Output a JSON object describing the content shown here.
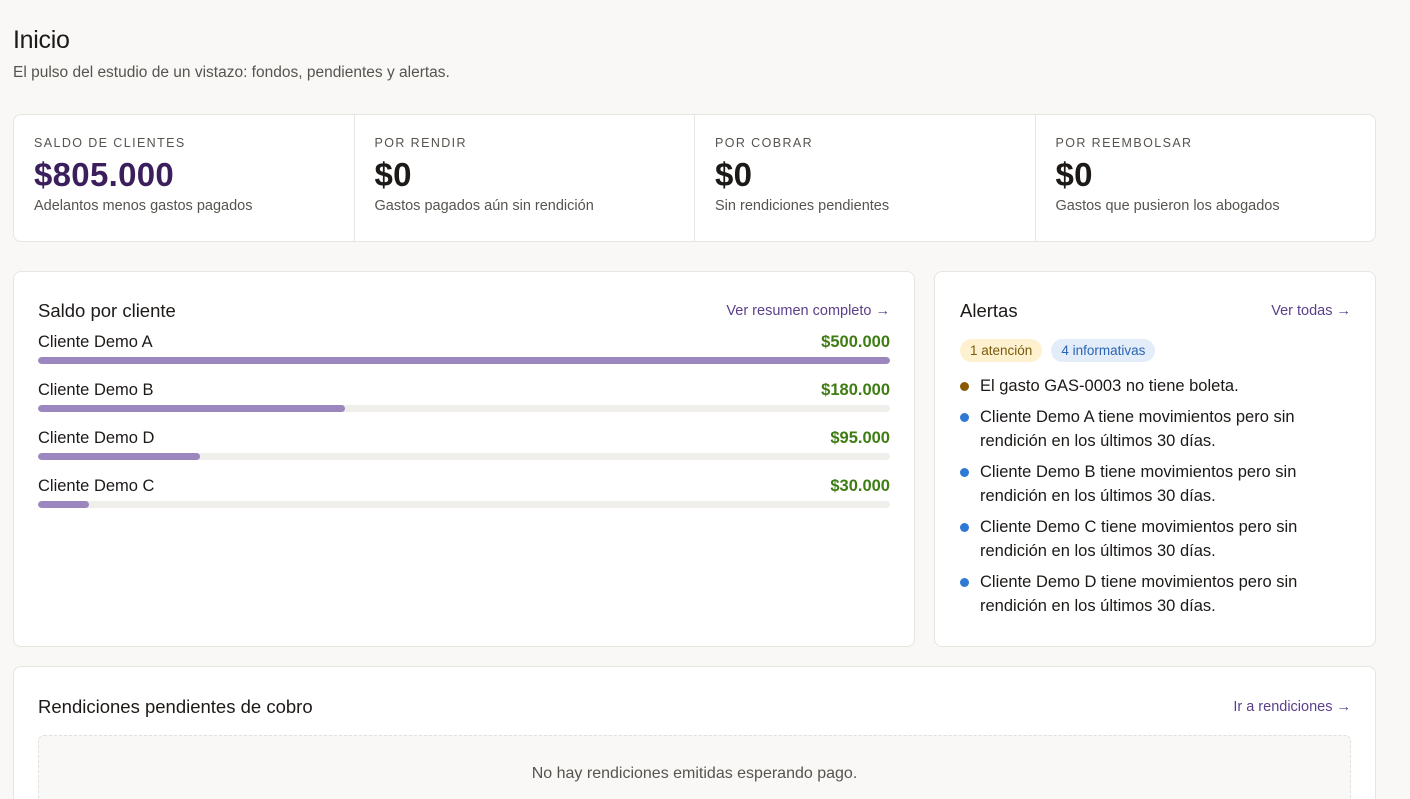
{
  "page": {
    "title": "Inicio",
    "subtitle": "El pulso del estudio de un vistazo: fondos, pendientes y alertas."
  },
  "stats": [
    {
      "label": "Saldo de clientes",
      "value": "$805.000",
      "description": "Adelantos menos gastos pagados",
      "accent": "#3b1f5c"
    },
    {
      "label": "Por rendir",
      "value": "$0",
      "description": "Gastos pagados aún sin rendición"
    },
    {
      "label": "Por cobrar",
      "value": "$0",
      "description": "Sin rendiciones pendientes"
    },
    {
      "label": "Por reembolsar",
      "value": "$0",
      "description": "Gastos que pusieron los abogados"
    }
  ],
  "clients_card": {
    "title": "Saldo por cliente",
    "link": "Ver resumen completo →",
    "clients": [
      {
        "name": "Cliente Demo A",
        "amount": "$500.000",
        "fraction": 1.0
      },
      {
        "name": "Cliente Demo B",
        "amount": "$180.000",
        "fraction": 0.36
      },
      {
        "name": "Cliente Demo D",
        "amount": "$95.000",
        "fraction": 0.19
      },
      {
        "name": "Cliente Demo C",
        "amount": "$30.000",
        "fraction": 0.06
      }
    ]
  },
  "alerts_card": {
    "title": "Alertas",
    "link": "Ver todas →",
    "badge_attention": "1 atención",
    "badge_info": "4 informativas",
    "alerts": [
      {
        "level": "warn",
        "text": "El gasto GAS-0003 no tiene boleta."
      },
      {
        "level": "info",
        "text": "Cliente Demo A tiene movimientos pero sin rendición en los últimos 30 días."
      },
      {
        "level": "info",
        "text": "Cliente Demo B tiene movimientos pero sin rendición en los últimos 30 días."
      },
      {
        "level": "info",
        "text": "Cliente Demo C tiene movimientos pero sin rendición en los últimos 30 días."
      },
      {
        "level": "info",
        "text": "Cliente Demo D tiene movimientos pero sin rendición en los últimos 30 días."
      }
    ]
  },
  "pending_card": {
    "title": "Rendiciones pendientes de cobro",
    "link": "Ir a rendiciones →",
    "empty_text": "No hay rendiciones emitidas esperando pago."
  },
  "colors": {
    "bar_fill": "#9b86bd",
    "amount_green": "#3f7d14",
    "link_purple": "#5b3f8a",
    "warn_dot": "#8a5a00",
    "info_dot": "#2f78d4"
  }
}
